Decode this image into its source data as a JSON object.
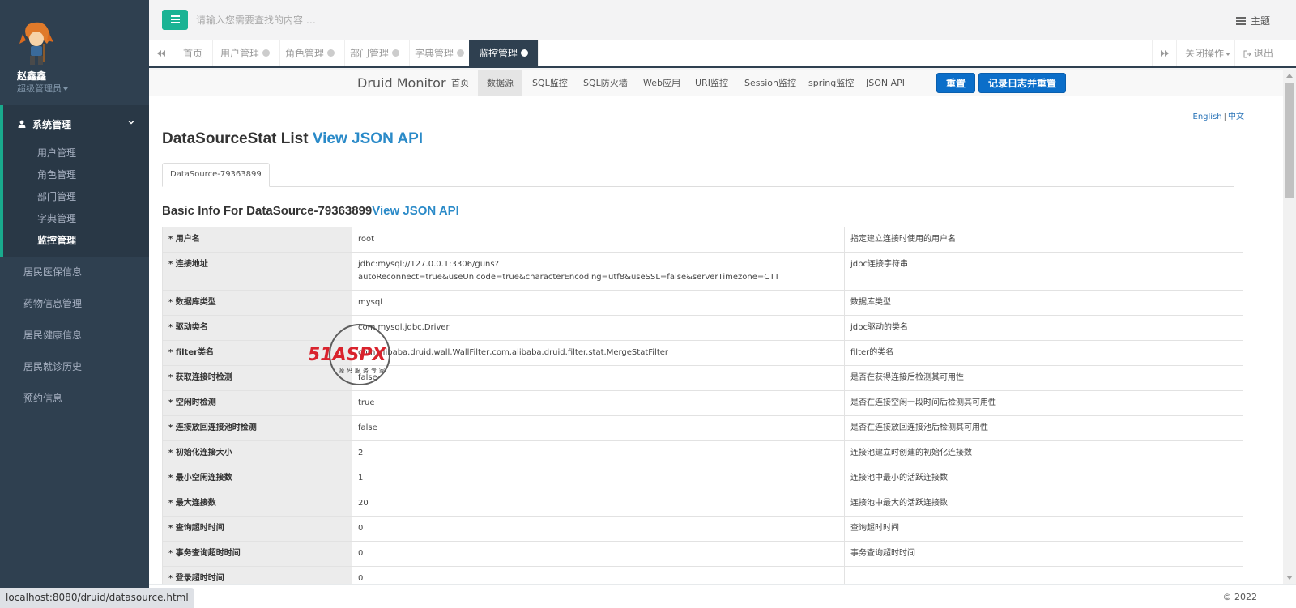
{
  "sidebar": {
    "user_name": "赵鑫鑫",
    "user_role": "超级管理员",
    "group_label": "系统管理",
    "sub_items": [
      "用户管理",
      "角色管理",
      "部门管理",
      "字典管理",
      "监控管理"
    ],
    "active_sub": "监控管理",
    "items": [
      "居民医保信息",
      "药物信息管理",
      "居民健康信息",
      "居民就诊历史",
      "预约信息"
    ]
  },
  "topbar": {
    "search_placeholder": "请输入您需要查找的内容 …",
    "theme_label": "主题"
  },
  "tabs": {
    "items": [
      "首页",
      "用户管理",
      "角色管理",
      "部门管理",
      "字典管理",
      "监控管理"
    ],
    "active": "监控管理",
    "close_ops": "关闭操作",
    "logout": "退出"
  },
  "druid": {
    "brand": "Druid Monitor",
    "nav": [
      "首页",
      "数据源",
      "SQL监控",
      "SQL防火墙",
      "Web应用",
      "URI监控",
      "Session监控",
      "spring监控",
      "JSON API"
    ],
    "active_nav": "数据源",
    "reset_button": "重置",
    "log_reset_button": "记录日志并重置",
    "lang_en": "English",
    "lang_sep": "|",
    "lang_zh": "中文",
    "list_title": "DataSourceStat List",
    "view_json": "View JSON API",
    "datasource_tab": "DataSource-79363899",
    "basic_title": "Basic Info For DataSource-79363899",
    "basic_view_json": "View JSON API",
    "rows": [
      {
        "key": "* 用户名",
        "value": "root",
        "desc": "指定建立连接时使用的用户名"
      },
      {
        "key": "* 连接地址",
        "value": "jdbc:mysql://127.0.0.1:3306/guns?",
        "value2": "autoReconnect=true&useUnicode=true&characterEncoding=utf8&useSSL=false&serverTimezone=CTT",
        "desc": "jdbc连接字符串"
      },
      {
        "key": "* 数据库类型",
        "value": "mysql",
        "desc": "数据库类型"
      },
      {
        "key": "* 驱动类名",
        "value": "com.mysql.jdbc.Driver",
        "desc": "jdbc驱动的类名"
      },
      {
        "key": "* filter类名",
        "value": "com.alibaba.druid.wall.WallFilter,com.alibaba.druid.filter.stat.MergeStatFilter",
        "desc": "filter的类名"
      },
      {
        "key": "* 获取连接时检测",
        "value": "false",
        "desc": "是否在获得连接后检测其可用性"
      },
      {
        "key": "* 空闲时检测",
        "value": "true",
        "desc": "是否在连接空闲一段时间后检测其可用性"
      },
      {
        "key": "* 连接放回连接池时检测",
        "value": "false",
        "desc": "是否在连接放回连接池后检测其可用性"
      },
      {
        "key": "* 初始化连接大小",
        "value": "2",
        "desc": "连接池建立时创建的初始化连接数"
      },
      {
        "key": "* 最小空闲连接数",
        "value": "1",
        "desc": "连接池中最小的活跃连接数"
      },
      {
        "key": "* 最大连接数",
        "value": "20",
        "desc": "连接池中最大的活跃连接数"
      },
      {
        "key": "* 查询超时时间",
        "value": "0",
        "desc": "查询超时时间"
      },
      {
        "key": "* 事务查询超时时间",
        "value": "0",
        "desc": "事务查询超时时间"
      },
      {
        "key": "* 登录超时时间",
        "value": "0",
        "desc": ""
      }
    ]
  },
  "footer": {
    "copyright": "© 2022",
    "status_url": "localhost:8080/druid/datasource.html"
  },
  "watermark": {
    "brand": "51ASPX",
    "tagline": "源码服务专家"
  },
  "colors": {
    "sidebar_bg": "#2f4050",
    "accent_green": "#1ab394",
    "link_blue": "#2a8ac8",
    "button_blue": "#0b6ec9"
  }
}
